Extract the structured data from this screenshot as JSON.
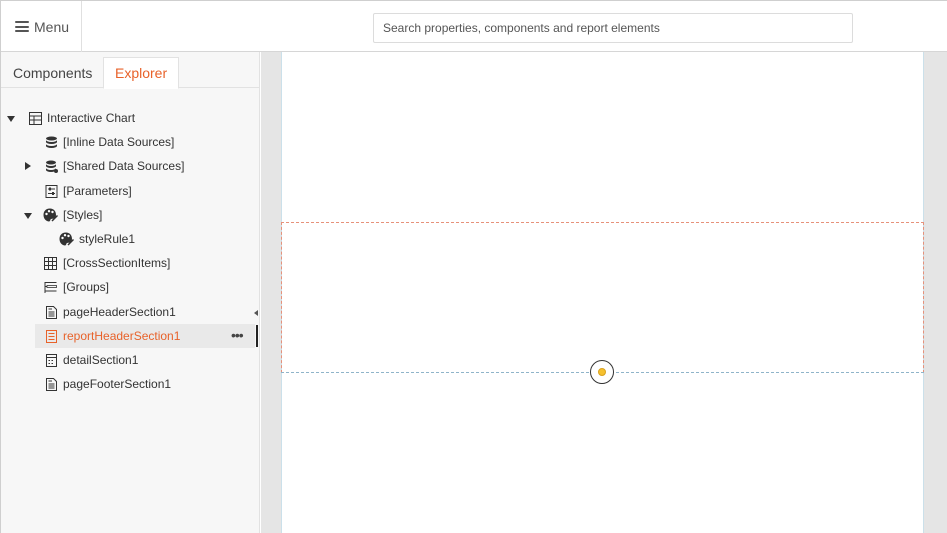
{
  "topbar": {
    "menu_label": "Menu",
    "search_placeholder": "Search properties, components and report elements"
  },
  "tabs": {
    "components": "Components",
    "explorer": "Explorer"
  },
  "tree": {
    "root": "Interactive Chart",
    "inline_data_sources": "[Inline Data Sources]",
    "shared_data_sources": "[Shared Data Sources]",
    "parameters": "[Parameters]",
    "styles": "[Styles]",
    "style_rule": "styleRule1",
    "cross_section_items": "[CrossSectionItems]",
    "groups": "[Groups]",
    "page_header": "pageHeaderSection1",
    "report_header": "reportHeaderSection1",
    "detail": "detailSection1",
    "page_footer": "pageFooterSection1",
    "more": "•••"
  },
  "colors": {
    "accent": "#e8622a",
    "selection_border": "#e6917a",
    "handle": "#f6c12f"
  },
  "icons": {
    "menu": "hamburger-icon",
    "report": "report-table-icon",
    "database": "database-icon",
    "parameters": "parameters-icon",
    "styles": "palette-icon",
    "cross_section": "grid-icon",
    "groups": "groups-icon",
    "section": "document-icon",
    "detail": "detail-section-icon"
  }
}
